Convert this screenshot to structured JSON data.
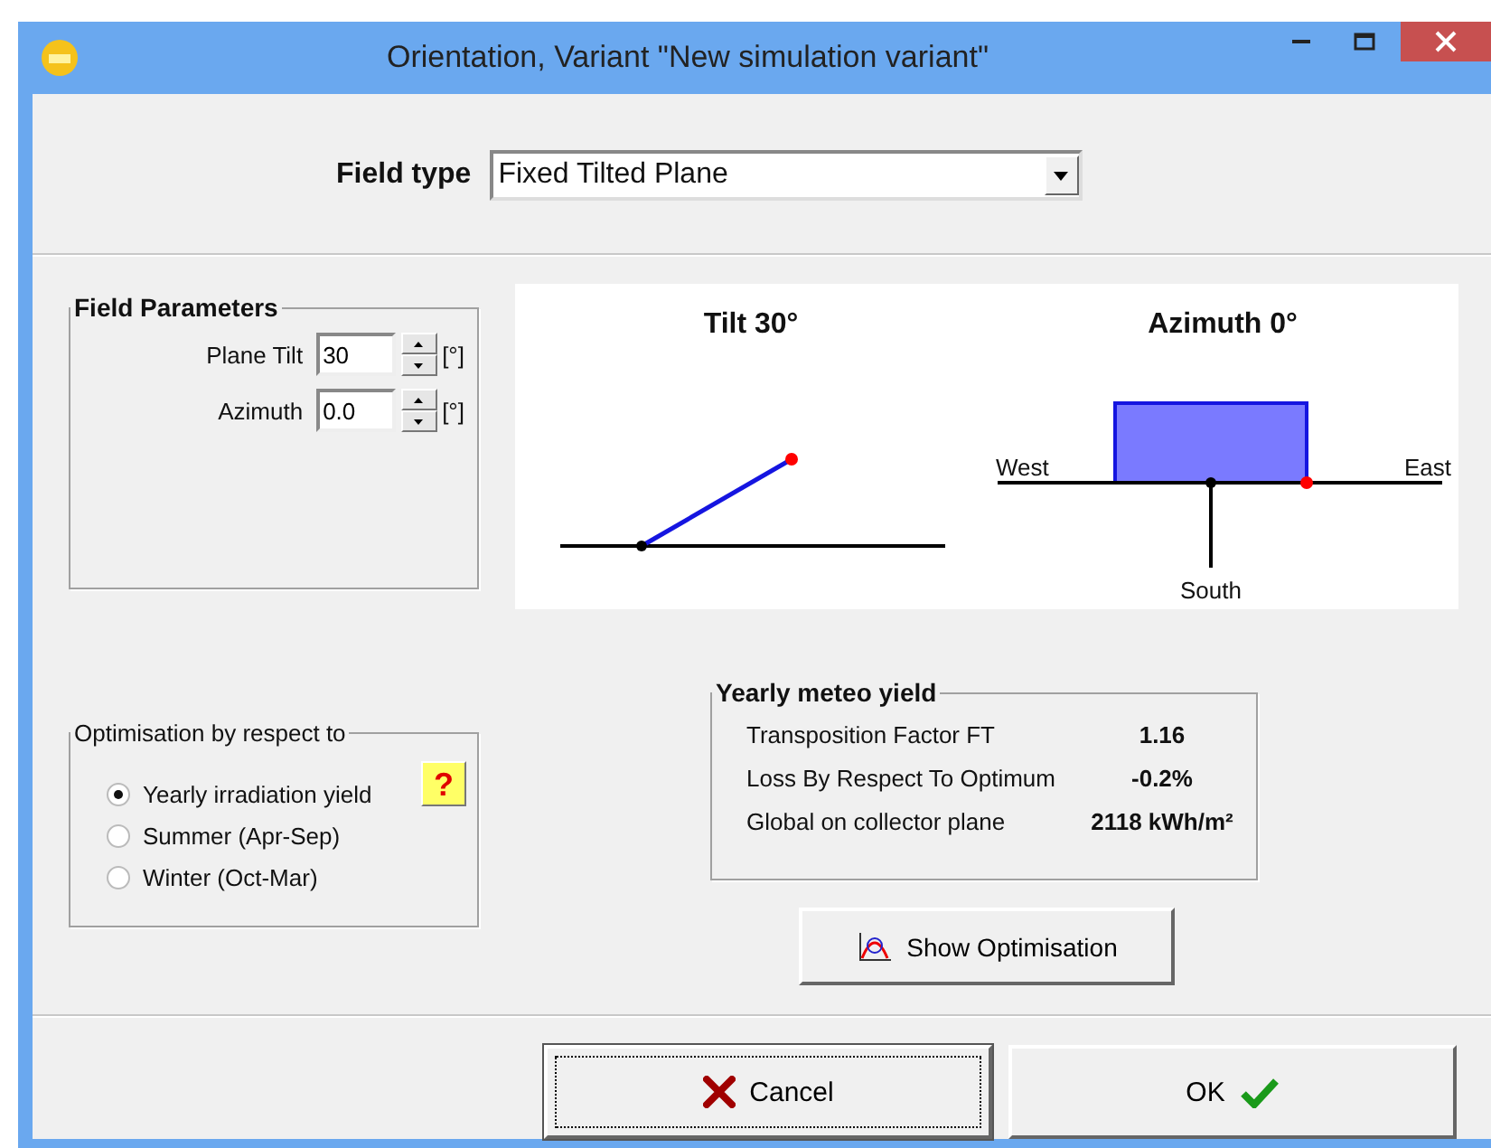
{
  "window": {
    "title": "Orientation, Variant \"New simulation variant\""
  },
  "field_type": {
    "label": "Field type",
    "value": "Fixed Tilted Plane"
  },
  "field_parameters": {
    "title": "Field Parameters",
    "rows": [
      {
        "label": "Plane Tilt",
        "value": "30",
        "unit": "[°]"
      },
      {
        "label": "Azimuth",
        "value": "0.0",
        "unit": "[°]"
      }
    ]
  },
  "diagram": {
    "tilt_title": "Tilt 30°",
    "azimuth_title": "Azimuth 0°",
    "west": "West",
    "east": "East",
    "south": "South"
  },
  "optimisation": {
    "title": "Optimisation by respect to",
    "help": "?",
    "options": [
      {
        "label": "Yearly irradiation yield",
        "selected": true
      },
      {
        "label": "Summer (Apr-Sep)",
        "selected": false
      },
      {
        "label": "Winter (Oct-Mar)",
        "selected": false
      }
    ]
  },
  "yearly_meteo_yield": {
    "title": "Yearly meteo yield",
    "rows": [
      {
        "label": "Transposition Factor FT",
        "value": "1.16"
      },
      {
        "label": "Loss By Respect To Optimum",
        "value": "-0.2%"
      },
      {
        "label": "Global on collector plane",
        "value": "2118 kWh/m²"
      }
    ]
  },
  "show_optimisation_button": {
    "label": "Show Optimisation"
  },
  "buttons": [
    {
      "kind": "cancel",
      "label": "Cancel",
      "focused": true
    },
    {
      "kind": "ok",
      "label": "OK",
      "focused": false
    }
  ]
}
